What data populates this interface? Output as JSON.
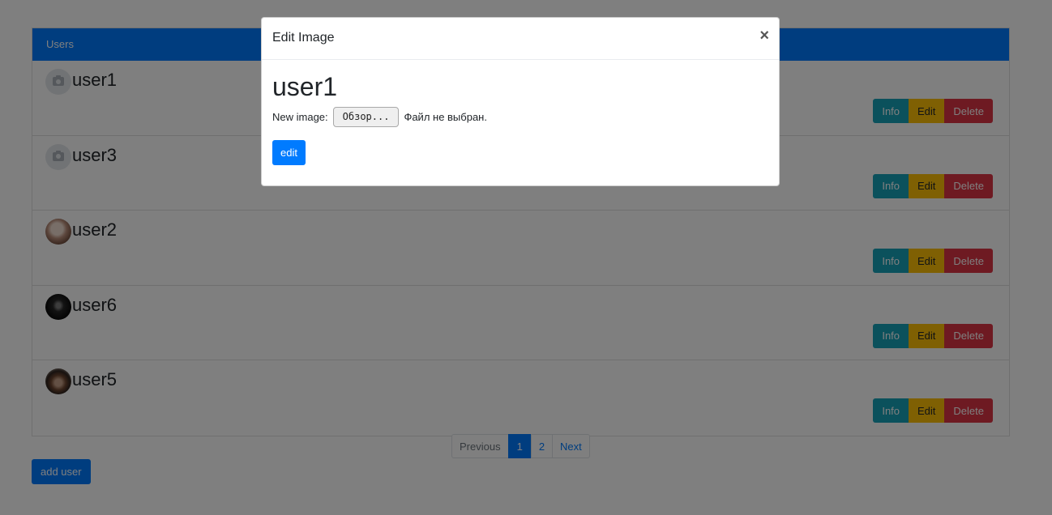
{
  "panel": {
    "header": "Users",
    "users": [
      {
        "name": "user1",
        "avatar": "camera-placeholder"
      },
      {
        "name": "user3",
        "avatar": "camera-placeholder"
      },
      {
        "name": "user2",
        "avatar": "photo"
      },
      {
        "name": "user6",
        "avatar": "photo"
      },
      {
        "name": "user5",
        "avatar": "photo"
      }
    ],
    "actions": {
      "info": "Info",
      "edit": "Edit",
      "delete": "Delete"
    }
  },
  "pagination": {
    "previous": "Previous",
    "pages": [
      "1",
      "2"
    ],
    "active_page": "1",
    "next": "Next"
  },
  "add_user_label": "add user",
  "modal": {
    "title": "Edit Image",
    "close": "×",
    "username": "user1",
    "file_label": "New image:",
    "browse_label": "Обзор...",
    "file_status": "Файл не выбран.",
    "submit_label": "edit"
  },
  "colors": {
    "primary": "#007bff",
    "info": "#17a2b8",
    "warning": "#ffc107",
    "danger": "#dc3545"
  }
}
